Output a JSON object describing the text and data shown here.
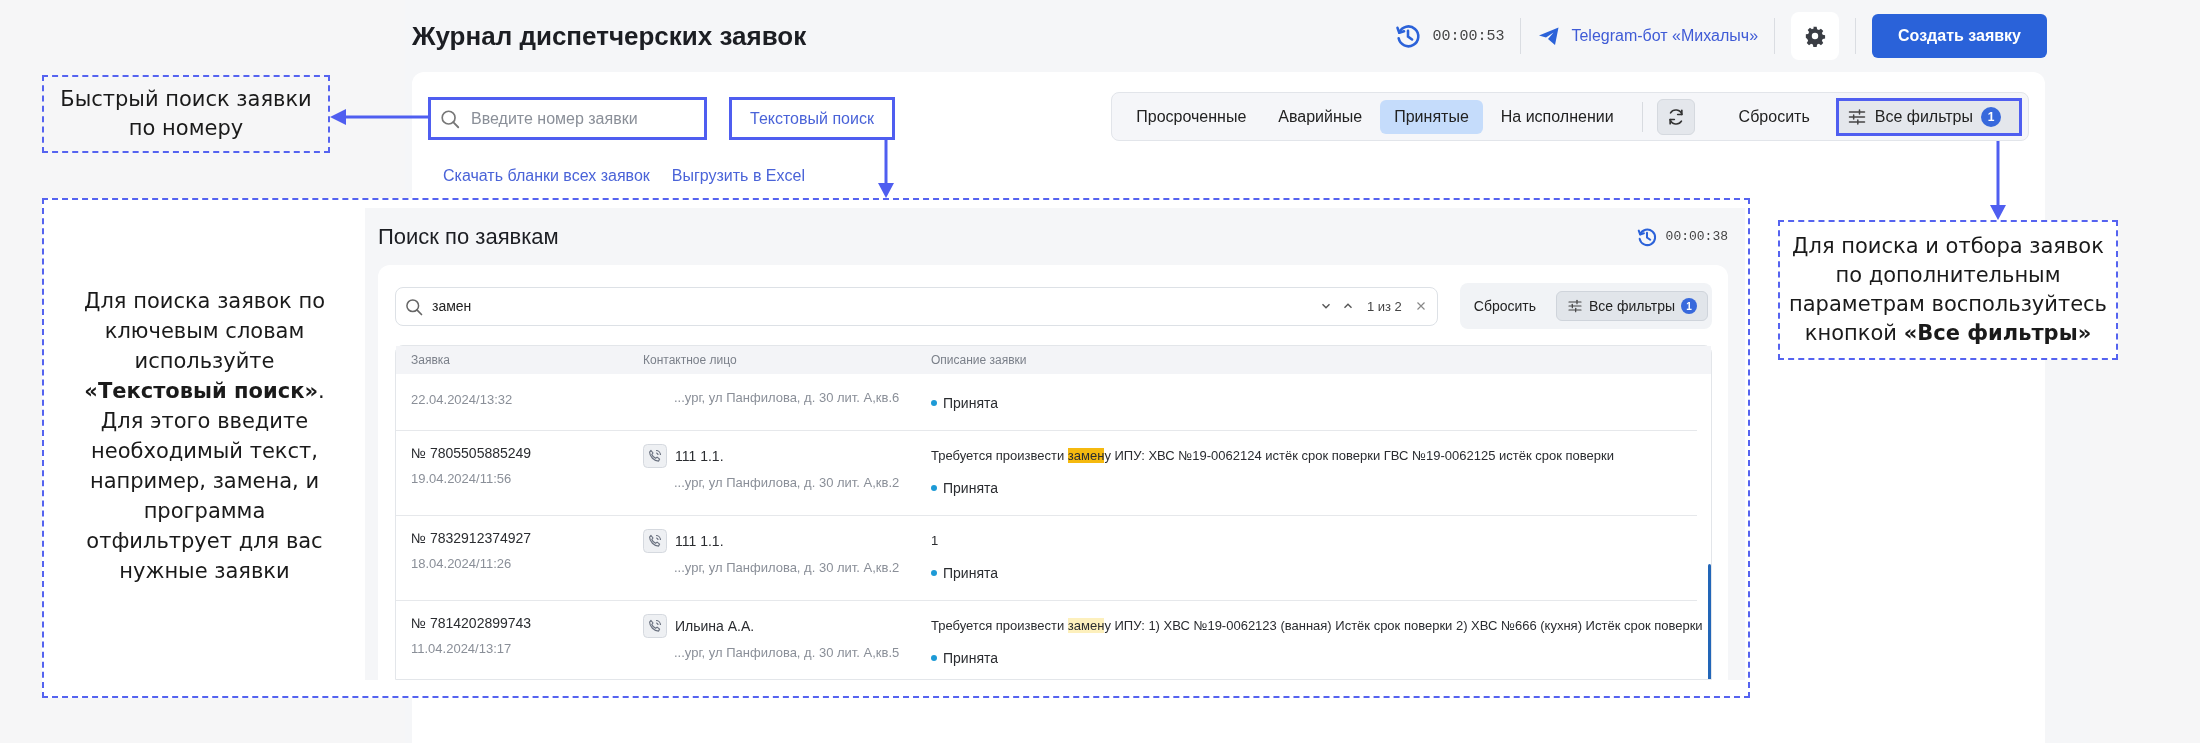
{
  "header": {
    "title": "Журнал диспетчерских заявок",
    "timer": "00:00:53",
    "telegram_link": "Telegram-бот «Михалыч»",
    "create_button": "Создать заявку"
  },
  "toolbar": {
    "quick_search": {
      "placeholder": "Введите номер заявки"
    },
    "text_search_link": "Текстовый поиск",
    "links": [
      "Скачать бланки всех заявок",
      "Выгрузить в Excel"
    ],
    "status_filters": [
      {
        "label": "Просроченные",
        "selected": false
      },
      {
        "label": "Аварийные",
        "selected": false
      },
      {
        "label": "Принятые",
        "selected": true
      },
      {
        "label": "На исполнении",
        "selected": false
      }
    ],
    "reset_button": "Сбросить",
    "all_filters": {
      "label": "Все фильтры",
      "badge": "1"
    }
  },
  "notes": [
    {
      "text": "Быстрый поиск заявки по номеру"
    },
    {
      "text": "Для поиска заявок по ключевым словам используйте **«Текстовый поиск»**. Для этого введите необходимый текст, например, замена, и программа отфильтрует для вас нужные заявки"
    },
    {
      "text": "Для поиска и отбора заявок по дополнительным параметрам воспользуйтесь кнопкой **«Все фильтры»**"
    }
  ],
  "search_panel": {
    "title": "Поиск по заявкам",
    "timer": "00:00:38",
    "search": {
      "value": "замен",
      "counter": "1 из 2"
    },
    "reset_button": "Сбросить",
    "all_filters": {
      "label": "Все фильтры",
      "badge": "1"
    },
    "columns": [
      "Заявка",
      "Контактное лицо",
      "Описание заявки"
    ],
    "rows": [
      {
        "clipped": true,
        "date": "22.04.2024/13:32",
        "address": "...ург, ул Панфилова, д. 30 лит. А,кв.6",
        "status": "Принята"
      },
      {
        "clipped": false,
        "number": "№ 7805505885249",
        "date": "19.04.2024/11:56",
        "contact": "111 1.1.",
        "address": "...ург, ул Панфилова, д. 30 лит. А,кв.2",
        "description": [
          {
            "text": "Требуется произвести ",
            "match": false,
            "current": false
          },
          {
            "text": "замен",
            "match": true,
            "current": true
          },
          {
            "text": "у ИПУ: ХВС №19-0062124 истёк срок поверки ГВС №19-0062125 истёк срок поверки",
            "match": false,
            "current": false
          }
        ],
        "status": "Принята"
      },
      {
        "clipped": false,
        "number": "№ 7832912374927",
        "date": "18.04.2024/11:26",
        "contact": "111 1.1.",
        "address": "...ург, ул Панфилова, д. 30 лит. А,кв.2",
        "description": [
          {
            "text": "1",
            "match": false,
            "current": false
          }
        ],
        "status": "Принята"
      },
      {
        "clipped": false,
        "number": "№ 7814202899743",
        "date": "11.04.2024/13:17",
        "contact": "Ильина А.А.",
        "address": "...ург, ул Панфилова, д. 30 лит. А,кв.5",
        "description": [
          {
            "text": "Требуется произвести ",
            "match": false,
            "current": false
          },
          {
            "text": "замен",
            "match": true,
            "current": false
          },
          {
            "text": "у ИПУ: 1) ХВС №19-0062123 (ванная) Истёк срок поверки 2) ХВС №666 (кухня) Истёк срок поверки",
            "match": false,
            "current": false
          }
        ],
        "status": "Принята"
      }
    ]
  }
}
